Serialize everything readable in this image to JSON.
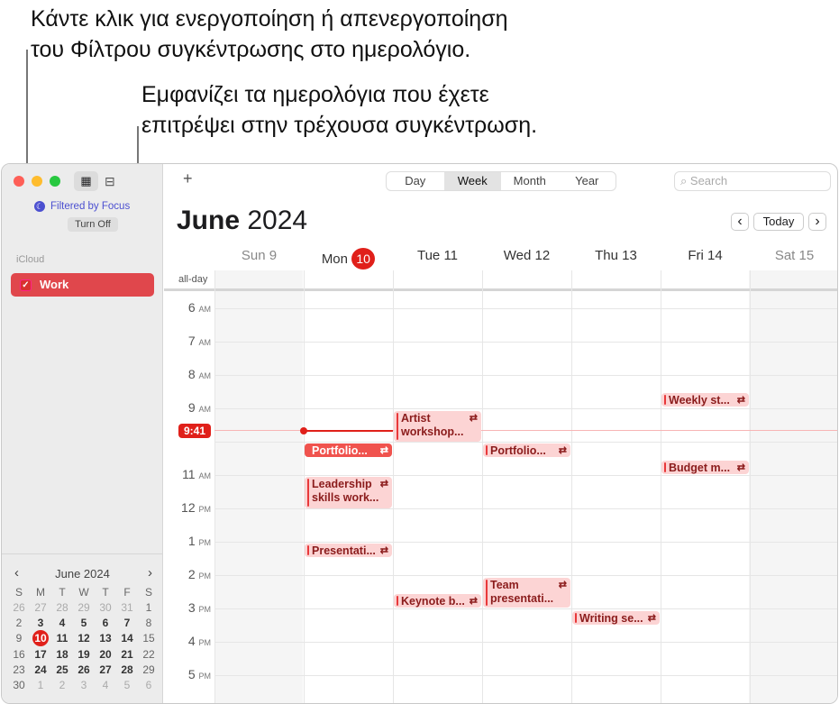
{
  "callouts": {
    "focus_filter": [
      "Κάντε κλικ για ενεργοποίηση ή απενεργοποίηση",
      "του Φίλτρου συγκέντρωσης στο ημερολόγιο."
    ],
    "calendars": [
      "Εμφανίζει τα ημερολόγια που έχετε",
      "επιτρέψει στην τρέχουσα συγκέντρωση."
    ]
  },
  "sidebar": {
    "focus_label": "Filtered by Focus",
    "turn_off": "Turn Off",
    "group": "iCloud",
    "calendars": [
      {
        "name": "Work",
        "color": "#e0474c",
        "checked": true
      }
    ]
  },
  "mini_calendar": {
    "title": "June 2024",
    "weekdays": [
      "S",
      "M",
      "T",
      "W",
      "T",
      "F",
      "S"
    ],
    "weeks": [
      [
        "26",
        "27",
        "28",
        "29",
        "30",
        "31",
        "1"
      ],
      [
        "2",
        "3",
        "4",
        "5",
        "6",
        "7",
        "8"
      ],
      [
        "9",
        "10",
        "11",
        "12",
        "13",
        "14",
        "15"
      ],
      [
        "16",
        "17",
        "18",
        "19",
        "20",
        "21",
        "22"
      ],
      [
        "23",
        "24",
        "25",
        "26",
        "27",
        "28",
        "29"
      ],
      [
        "30",
        "1",
        "2",
        "3",
        "4",
        "5",
        "6"
      ]
    ],
    "today": "10"
  },
  "toolbar": {
    "add": "+",
    "views": [
      "Day",
      "Week",
      "Month",
      "Year"
    ],
    "selected_view": "Week",
    "search_placeholder": "Search",
    "today": "Today"
  },
  "header": {
    "month": "June",
    "year": "2024"
  },
  "days": [
    {
      "name": "Sun",
      "num": "9"
    },
    {
      "name": "Mon",
      "num": "10",
      "today": true
    },
    {
      "name": "Tue",
      "num": "11"
    },
    {
      "name": "Wed",
      "num": "12"
    },
    {
      "name": "Thu",
      "num": "13"
    },
    {
      "name": "Fri",
      "num": "14"
    },
    {
      "name": "Sat",
      "num": "15"
    }
  ],
  "all_day_label": "all-day",
  "hours": [
    {
      "h": "6",
      "ap": "AM"
    },
    {
      "h": "7",
      "ap": "AM"
    },
    {
      "h": "8",
      "ap": "AM"
    },
    {
      "h": "9",
      "ap": "AM"
    },
    {
      "h": "10",
      "ap": "AM"
    },
    {
      "h": "11",
      "ap": "AM"
    },
    {
      "h": "12",
      "ap": "PM"
    },
    {
      "h": "1",
      "ap": "PM"
    },
    {
      "h": "2",
      "ap": "PM"
    },
    {
      "h": "3",
      "ap": "PM"
    },
    {
      "h": "4",
      "ap": "PM"
    },
    {
      "h": "5",
      "ap": "PM"
    }
  ],
  "now": "9:41",
  "accent": "#e0201a",
  "events": [
    {
      "title": "Weekly st...",
      "day": "Fri",
      "repeat": true
    },
    {
      "title": "Artist workshop...",
      "lines": [
        "Artist",
        "workshop..."
      ],
      "day": "Tue",
      "repeat": true
    },
    {
      "title": "Portfolio...",
      "day": "Mon",
      "repeat": true,
      "selected": true
    },
    {
      "title": "Portfolio...",
      "day": "Wed",
      "repeat": true
    },
    {
      "title": "Budget m...",
      "day": "Fri",
      "repeat": true
    },
    {
      "title": "Leadership skills work...",
      "lines": [
        "Leadership",
        "skills work..."
      ],
      "day": "Mon",
      "repeat": true
    },
    {
      "title": "Presentati...",
      "day": "Mon",
      "repeat": true
    },
    {
      "title": "Keynote b...",
      "day": "Tue",
      "repeat": true
    },
    {
      "title": "Team presentati...",
      "lines": [
        "Team",
        "presentati..."
      ],
      "day": "Wed",
      "repeat": true
    },
    {
      "title": "Writing se...",
      "day": "Thu",
      "repeat": true
    }
  ]
}
